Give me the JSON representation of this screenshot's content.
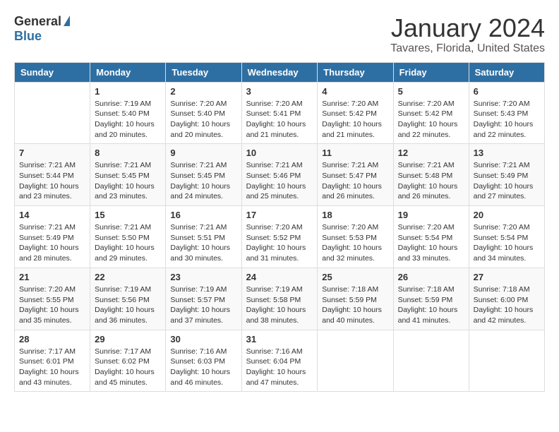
{
  "logo": {
    "general": "General",
    "blue": "Blue"
  },
  "title": "January 2024",
  "subtitle": "Tavares, Florida, United States",
  "weekdays": [
    "Sunday",
    "Monday",
    "Tuesday",
    "Wednesday",
    "Thursday",
    "Friday",
    "Saturday"
  ],
  "weeks": [
    [
      {
        "day": "",
        "sunrise": "",
        "sunset": "",
        "daylight": ""
      },
      {
        "day": "1",
        "sunrise": "Sunrise: 7:19 AM",
        "sunset": "Sunset: 5:40 PM",
        "daylight": "Daylight: 10 hours and 20 minutes."
      },
      {
        "day": "2",
        "sunrise": "Sunrise: 7:20 AM",
        "sunset": "Sunset: 5:40 PM",
        "daylight": "Daylight: 10 hours and 20 minutes."
      },
      {
        "day": "3",
        "sunrise": "Sunrise: 7:20 AM",
        "sunset": "Sunset: 5:41 PM",
        "daylight": "Daylight: 10 hours and 21 minutes."
      },
      {
        "day": "4",
        "sunrise": "Sunrise: 7:20 AM",
        "sunset": "Sunset: 5:42 PM",
        "daylight": "Daylight: 10 hours and 21 minutes."
      },
      {
        "day": "5",
        "sunrise": "Sunrise: 7:20 AM",
        "sunset": "Sunset: 5:42 PM",
        "daylight": "Daylight: 10 hours and 22 minutes."
      },
      {
        "day": "6",
        "sunrise": "Sunrise: 7:20 AM",
        "sunset": "Sunset: 5:43 PM",
        "daylight": "Daylight: 10 hours and 22 minutes."
      }
    ],
    [
      {
        "day": "7",
        "sunrise": "Sunrise: 7:21 AM",
        "sunset": "Sunset: 5:44 PM",
        "daylight": "Daylight: 10 hours and 23 minutes."
      },
      {
        "day": "8",
        "sunrise": "Sunrise: 7:21 AM",
        "sunset": "Sunset: 5:45 PM",
        "daylight": "Daylight: 10 hours and 23 minutes."
      },
      {
        "day": "9",
        "sunrise": "Sunrise: 7:21 AM",
        "sunset": "Sunset: 5:45 PM",
        "daylight": "Daylight: 10 hours and 24 minutes."
      },
      {
        "day": "10",
        "sunrise": "Sunrise: 7:21 AM",
        "sunset": "Sunset: 5:46 PM",
        "daylight": "Daylight: 10 hours and 25 minutes."
      },
      {
        "day": "11",
        "sunrise": "Sunrise: 7:21 AM",
        "sunset": "Sunset: 5:47 PM",
        "daylight": "Daylight: 10 hours and 26 minutes."
      },
      {
        "day": "12",
        "sunrise": "Sunrise: 7:21 AM",
        "sunset": "Sunset: 5:48 PM",
        "daylight": "Daylight: 10 hours and 26 minutes."
      },
      {
        "day": "13",
        "sunrise": "Sunrise: 7:21 AM",
        "sunset": "Sunset: 5:49 PM",
        "daylight": "Daylight: 10 hours and 27 minutes."
      }
    ],
    [
      {
        "day": "14",
        "sunrise": "Sunrise: 7:21 AM",
        "sunset": "Sunset: 5:49 PM",
        "daylight": "Daylight: 10 hours and 28 minutes."
      },
      {
        "day": "15",
        "sunrise": "Sunrise: 7:21 AM",
        "sunset": "Sunset: 5:50 PM",
        "daylight": "Daylight: 10 hours and 29 minutes."
      },
      {
        "day": "16",
        "sunrise": "Sunrise: 7:21 AM",
        "sunset": "Sunset: 5:51 PM",
        "daylight": "Daylight: 10 hours and 30 minutes."
      },
      {
        "day": "17",
        "sunrise": "Sunrise: 7:20 AM",
        "sunset": "Sunset: 5:52 PM",
        "daylight": "Daylight: 10 hours and 31 minutes."
      },
      {
        "day": "18",
        "sunrise": "Sunrise: 7:20 AM",
        "sunset": "Sunset: 5:53 PM",
        "daylight": "Daylight: 10 hours and 32 minutes."
      },
      {
        "day": "19",
        "sunrise": "Sunrise: 7:20 AM",
        "sunset": "Sunset: 5:54 PM",
        "daylight": "Daylight: 10 hours and 33 minutes."
      },
      {
        "day": "20",
        "sunrise": "Sunrise: 7:20 AM",
        "sunset": "Sunset: 5:54 PM",
        "daylight": "Daylight: 10 hours and 34 minutes."
      }
    ],
    [
      {
        "day": "21",
        "sunrise": "Sunrise: 7:20 AM",
        "sunset": "Sunset: 5:55 PM",
        "daylight": "Daylight: 10 hours and 35 minutes."
      },
      {
        "day": "22",
        "sunrise": "Sunrise: 7:19 AM",
        "sunset": "Sunset: 5:56 PM",
        "daylight": "Daylight: 10 hours and 36 minutes."
      },
      {
        "day": "23",
        "sunrise": "Sunrise: 7:19 AM",
        "sunset": "Sunset: 5:57 PM",
        "daylight": "Daylight: 10 hours and 37 minutes."
      },
      {
        "day": "24",
        "sunrise": "Sunrise: 7:19 AM",
        "sunset": "Sunset: 5:58 PM",
        "daylight": "Daylight: 10 hours and 38 minutes."
      },
      {
        "day": "25",
        "sunrise": "Sunrise: 7:18 AM",
        "sunset": "Sunset: 5:59 PM",
        "daylight": "Daylight: 10 hours and 40 minutes."
      },
      {
        "day": "26",
        "sunrise": "Sunrise: 7:18 AM",
        "sunset": "Sunset: 5:59 PM",
        "daylight": "Daylight: 10 hours and 41 minutes."
      },
      {
        "day": "27",
        "sunrise": "Sunrise: 7:18 AM",
        "sunset": "Sunset: 6:00 PM",
        "daylight": "Daylight: 10 hours and 42 minutes."
      }
    ],
    [
      {
        "day": "28",
        "sunrise": "Sunrise: 7:17 AM",
        "sunset": "Sunset: 6:01 PM",
        "daylight": "Daylight: 10 hours and 43 minutes."
      },
      {
        "day": "29",
        "sunrise": "Sunrise: 7:17 AM",
        "sunset": "Sunset: 6:02 PM",
        "daylight": "Daylight: 10 hours and 45 minutes."
      },
      {
        "day": "30",
        "sunrise": "Sunrise: 7:16 AM",
        "sunset": "Sunset: 6:03 PM",
        "daylight": "Daylight: 10 hours and 46 minutes."
      },
      {
        "day": "31",
        "sunrise": "Sunrise: 7:16 AM",
        "sunset": "Sunset: 6:04 PM",
        "daylight": "Daylight: 10 hours and 47 minutes."
      },
      {
        "day": "",
        "sunrise": "",
        "sunset": "",
        "daylight": ""
      },
      {
        "day": "",
        "sunrise": "",
        "sunset": "",
        "daylight": ""
      },
      {
        "day": "",
        "sunrise": "",
        "sunset": "",
        "daylight": ""
      }
    ]
  ]
}
